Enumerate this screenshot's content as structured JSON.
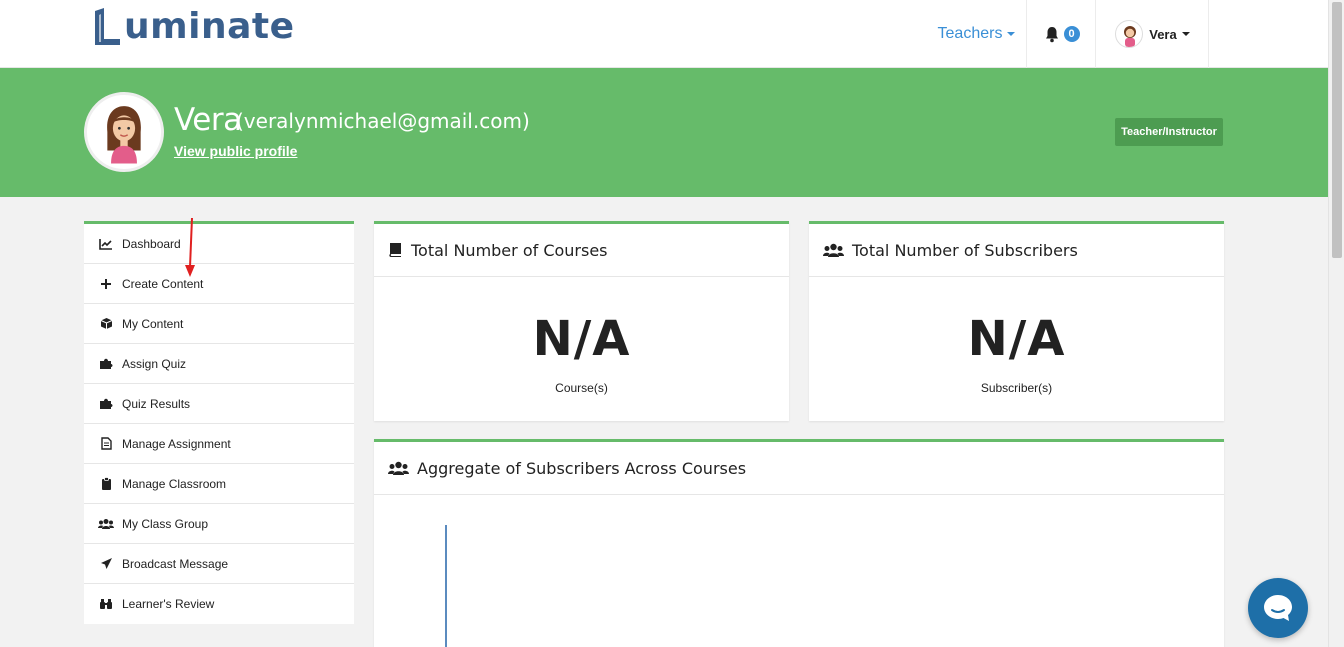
{
  "brand": {
    "logo_text": "uminate"
  },
  "topnav": {
    "teachers_label": "Teachers",
    "notification_count": "0",
    "user_name": "Vera"
  },
  "profile": {
    "name": "Vera",
    "email": "(veralynmichael@gmail.com)",
    "view_profile_label": "View public profile",
    "role": "Teacher/Instructor"
  },
  "sidebar": {
    "items": [
      {
        "label": "Dashboard",
        "icon": "chart-line-icon"
      },
      {
        "label": "Create Content",
        "icon": "plus-icon"
      },
      {
        "label": "My Content",
        "icon": "cube-icon"
      },
      {
        "label": "Assign Quiz",
        "icon": "puzzle-icon"
      },
      {
        "label": "Quiz Results",
        "icon": "puzzle-icon"
      },
      {
        "label": "Manage Assignment",
        "icon": "file-icon"
      },
      {
        "label": "Manage Classroom",
        "icon": "clipboard-icon"
      },
      {
        "label": "My Class Group",
        "icon": "users-icon"
      },
      {
        "label": "Broadcast Message",
        "icon": "paper-plane-icon"
      },
      {
        "label": "Learner's Review",
        "icon": "binoculars-icon"
      }
    ]
  },
  "cards": {
    "courses": {
      "title": "Total Number of Courses",
      "value": "N/A",
      "label": "Course(s)"
    },
    "subscribers": {
      "title": "Total Number of Subscribers",
      "value": "N/A",
      "label": "Subscriber(s)"
    },
    "aggregate": {
      "title": "Aggregate of Subscribers Across Courses"
    }
  },
  "colors": {
    "brand_green": "#66bb6a",
    "link_blue": "#3a8fd6",
    "logo_blue": "#3a5f8c",
    "chat_blue": "#1e6fa8"
  }
}
